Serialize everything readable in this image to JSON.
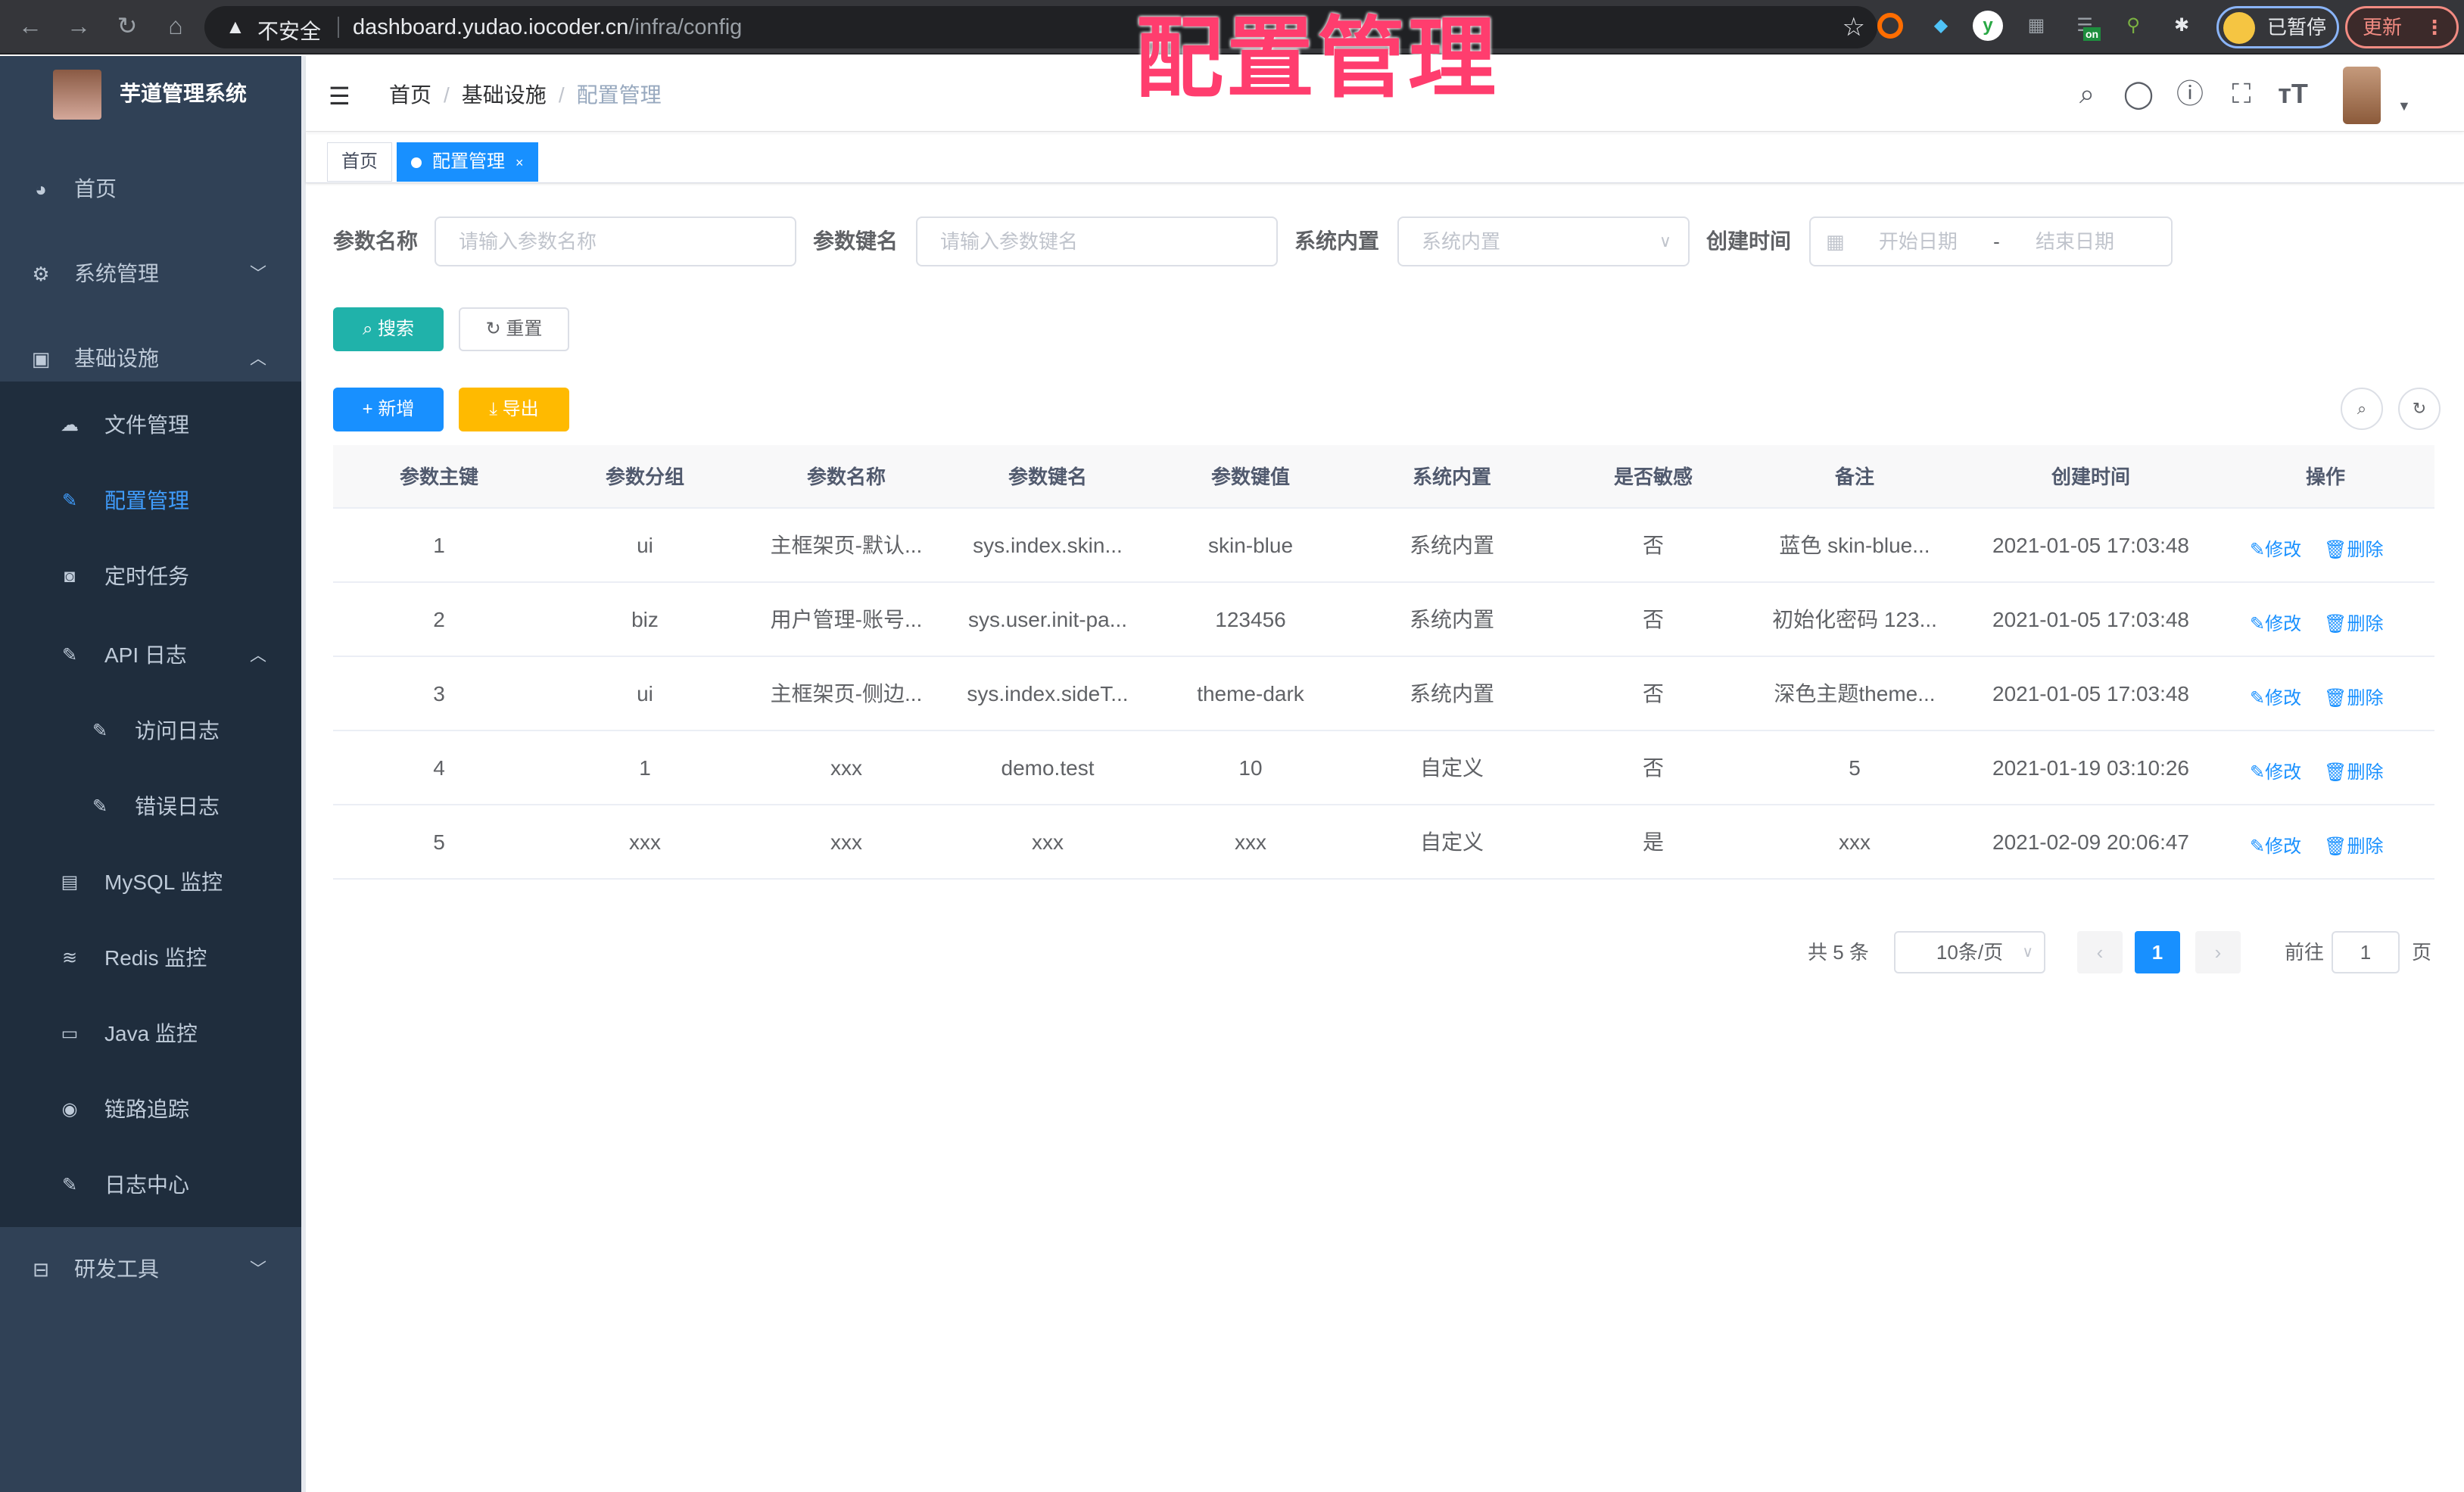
{
  "browser": {
    "security_label": "不安全",
    "url_host": "dashboard.yudao.iocoder.cn",
    "url_path": "/infra/config",
    "profile_status": "已暂停",
    "update_label": "更新",
    "extension_badge": "on"
  },
  "overlay_title": "配置管理",
  "sidebar": {
    "brand": "芋道管理系统",
    "items": [
      {
        "label": "首页",
        "icon": "dashboard-icon"
      },
      {
        "label": "系统管理",
        "icon": "gear-icon",
        "expanded": false
      },
      {
        "label": "基础设施",
        "icon": "monitor-icon",
        "expanded": true
      },
      {
        "label": "研发工具",
        "icon": "toolbox-icon",
        "expanded": false
      }
    ],
    "infra_children": [
      {
        "label": "文件管理",
        "icon": "cloud-upload-icon"
      },
      {
        "label": "配置管理",
        "icon": "edit-icon",
        "active": true
      },
      {
        "label": "定时任务",
        "icon": "job-icon"
      },
      {
        "label": "API 日志",
        "icon": "log-icon",
        "expanded": true
      },
      {
        "label": "访问日志",
        "icon": "log-icon"
      },
      {
        "label": "错误日志",
        "icon": "log-icon"
      },
      {
        "label": "MySQL 监控",
        "icon": "database-icon"
      },
      {
        "label": "Redis 监控",
        "icon": "redis-icon"
      },
      {
        "label": "Java 监控",
        "icon": "server-icon"
      },
      {
        "label": "链路追踪",
        "icon": "eye-icon"
      },
      {
        "label": "日志中心",
        "icon": "log-icon"
      }
    ]
  },
  "navbar": {
    "breadcrumb": [
      "首页",
      "基础设施",
      "配置管理"
    ]
  },
  "tags": [
    {
      "label": "首页"
    },
    {
      "label": "配置管理",
      "active": true,
      "close": "×"
    }
  ],
  "filters": {
    "name_label": "参数名称",
    "name_placeholder": "请输入参数名称",
    "key_label": "参数键名",
    "key_placeholder": "请输入参数键名",
    "type_label": "系统内置",
    "type_placeholder": "系统内置",
    "time_label": "创建时间",
    "start_placeholder": "开始日期",
    "range_sep": "-",
    "end_placeholder": "结束日期",
    "search_label": "搜索",
    "reset_label": "重置"
  },
  "toolbar": {
    "add_label": "新增",
    "export_label": "导出"
  },
  "table": {
    "columns": [
      "参数主键",
      "参数分组",
      "参数名称",
      "参数键名",
      "参数键值",
      "系统内置",
      "是否敏感",
      "备注",
      "创建时间",
      "操作"
    ],
    "rows": [
      [
        "1",
        "ui",
        "主框架页-默认...",
        "sys.index.skin...",
        "skin-blue",
        "系统内置",
        "否",
        "蓝色 skin-blue...",
        "2021-01-05 17:03:48"
      ],
      [
        "2",
        "biz",
        "用户管理-账号...",
        "sys.user.init-pa...",
        "123456",
        "系统内置",
        "否",
        "初始化密码 123...",
        "2021-01-05 17:03:48"
      ],
      [
        "3",
        "ui",
        "主框架页-侧边...",
        "sys.index.sideT...",
        "theme-dark",
        "系统内置",
        "否",
        "深色主题theme...",
        "2021-01-05 17:03:48"
      ],
      [
        "4",
        "1",
        "xxx",
        "demo.test",
        "10",
        "自定义",
        "否",
        "5",
        "2021-01-19 03:10:26"
      ],
      [
        "5",
        "xxx",
        "xxx",
        "xxx",
        "xxx",
        "自定义",
        "是",
        "xxx",
        "2021-02-09 20:06:47"
      ]
    ],
    "edit_label": "修改",
    "delete_label": "删除"
  },
  "pagination": {
    "total": "共 5 条",
    "page_size": "10条/页",
    "current": "1",
    "goto_label": "前往",
    "goto_value": "1",
    "page_suffix": "页"
  },
  "colors": {
    "primary": "#1890ff",
    "warning": "#ffba00",
    "search": "#20b2aa",
    "sidebar_bg": "#304156",
    "overlay_title": "#ff3d6e"
  }
}
